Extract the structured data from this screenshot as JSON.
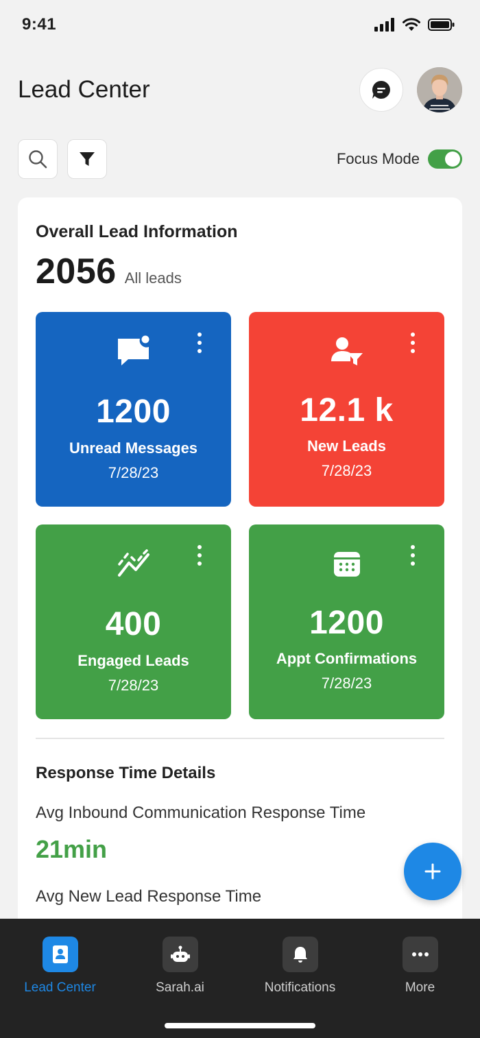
{
  "status_bar": {
    "time": "9:41"
  },
  "header": {
    "title": "Lead Center"
  },
  "toolbar": {
    "focus_label": "Focus Mode",
    "focus_on": true
  },
  "overview": {
    "title": "Overall Lead Information",
    "total": "2056",
    "total_label": "All leads",
    "tiles": [
      {
        "value": "1200",
        "label": "Unread Messages",
        "date": "7/28/23",
        "color": "#1565c0",
        "icon": "message-icon"
      },
      {
        "value": "12.1 k",
        "label": "New Leads",
        "date": "7/28/23",
        "color": "#f44336",
        "icon": "lead-filter-icon"
      },
      {
        "value": "400",
        "label": "Engaged Leads",
        "date": "7/28/23",
        "color": "#43a047",
        "icon": "trend-icon"
      },
      {
        "value": "1200",
        "label": "Appt Confirmations",
        "date": "7/28/23",
        "color": "#43a047",
        "icon": "calendar-icon"
      }
    ]
  },
  "response": {
    "title": "Response Time Details",
    "inbound_label": "Avg Inbound Communication Response Time",
    "inbound_value": "21min",
    "new_lead_label": "Avg New Lead Response Time"
  },
  "nav": [
    {
      "label": "Lead Center",
      "icon": "contact-card-icon",
      "active": true
    },
    {
      "label": "Sarah.ai",
      "icon": "robot-icon",
      "active": false
    },
    {
      "label": "Notifications",
      "icon": "bell-icon",
      "active": false
    },
    {
      "label": "More",
      "icon": "more-icon",
      "active": false
    }
  ],
  "colors": {
    "accent": "#1e88e5",
    "green": "#43a047",
    "red": "#f44336",
    "blue": "#1565c0",
    "nav_bg": "#232323"
  }
}
